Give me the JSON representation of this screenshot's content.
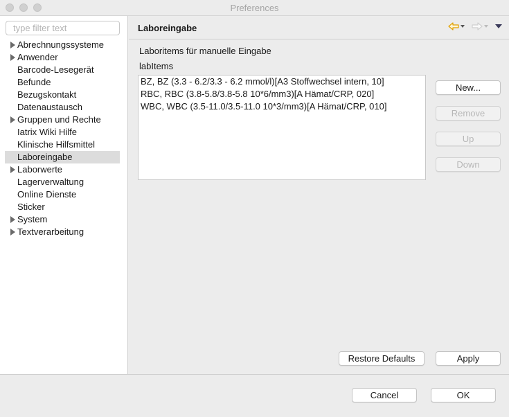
{
  "window": {
    "title": "Preferences"
  },
  "filter": {
    "placeholder": "type filter text"
  },
  "tree": {
    "items": [
      {
        "label": "Abrechnungssysteme",
        "expandable": true
      },
      {
        "label": "Anwender",
        "expandable": true
      },
      {
        "label": "Barcode-Lesegerät",
        "expandable": false
      },
      {
        "label": "Befunde",
        "expandable": false
      },
      {
        "label": "Bezugskontakt",
        "expandable": false
      },
      {
        "label": "Datenaustausch",
        "expandable": false
      },
      {
        "label": "Gruppen und Rechte",
        "expandable": true
      },
      {
        "label": "Iatrix Wiki Hilfe",
        "expandable": false
      },
      {
        "label": "Klinische Hilfsmittel",
        "expandable": false
      },
      {
        "label": "Laboreingabe",
        "expandable": false,
        "selected": true
      },
      {
        "label": "Laborwerte",
        "expandable": true
      },
      {
        "label": "Lagerverwaltung",
        "expandable": false
      },
      {
        "label": "Online Dienste",
        "expandable": false
      },
      {
        "label": "Sticker",
        "expandable": false
      },
      {
        "label": "System",
        "expandable": true
      },
      {
        "label": "Textverarbeitung",
        "expandable": true
      }
    ]
  },
  "page": {
    "title": "Laboreingabe",
    "section_label": "Laboritems für manuelle Eingabe",
    "list_label": "labItems",
    "items": [
      "BZ, BZ (3.3 - 6.2/3.3 - 6.2 mmol/l)[A3 Stoffwechsel intern, 10]",
      "RBC, RBC (3.8-5.8/3.8-5.8 10*6/mm3)[A Hämat/CRP, 020]",
      "WBC, WBC (3.5-11.0/3.5-11.0 10*3/mm3)[A Hämat/CRP, 010]"
    ],
    "buttons": {
      "new": "New...",
      "remove": "Remove",
      "up": "Up",
      "down": "Down",
      "restore_defaults": "Restore Defaults",
      "apply": "Apply"
    }
  },
  "dialog": {
    "cancel": "Cancel",
    "ok": "OK"
  },
  "colors": {
    "back_arrow": "#e0a000",
    "forward_arrow": "#d0d0d0",
    "selection": "#dcdcdc"
  }
}
